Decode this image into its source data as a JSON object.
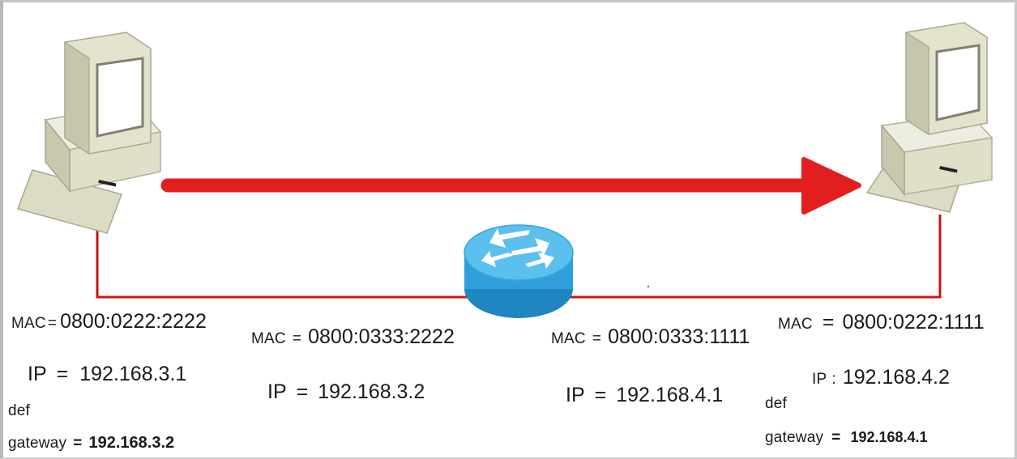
{
  "colors": {
    "arrow": "#e31e1e",
    "link": "#c81414",
    "router_body": "#2f9fdc",
    "router_top": "#5cc0ef",
    "pc_case": "#e6e6cf",
    "pc_shadow": "#c9c9ae"
  },
  "icons": {
    "left_pc": "desktop-computer-icon",
    "right_pc": "desktop-computer-icon",
    "router": "router-icon",
    "arrow": "arrow-right-icon"
  },
  "hosts": {
    "left": {
      "mac_key": "MAC",
      "mac_sep": "=",
      "mac_val": "0800:0222:2222",
      "ip_key": "IP",
      "ip_sep": "=",
      "ip_val": "192.168.3.1",
      "gw_line1": "def",
      "gw_key": "gateway",
      "gw_sep": "=",
      "gw_val": "192.168.3.2"
    },
    "right": {
      "mac_key": "MAC",
      "mac_sep": "=",
      "mac_val": "0800:0222:1111",
      "ip_key": "IP",
      "ip_sep": ":",
      "ip_val": "192.168.4.2",
      "gw_line1": "def",
      "gw_key": "gateway",
      "gw_sep": "=",
      "gw_val": "192.168.4.1"
    }
  },
  "router": {
    "left_interface": {
      "mac_key": "MAC",
      "mac_sep": "=",
      "mac_val": "0800:0333:2222",
      "ip_key": "IP",
      "ip_sep": "=",
      "ip_val": "192.168.3.2"
    },
    "right_interface": {
      "mac_key": "MAC",
      "mac_sep": "=",
      "mac_val": "0800:0333:1111",
      "ip_key": "IP",
      "ip_sep": "=",
      "ip_val": "192.168.4.1"
    }
  }
}
